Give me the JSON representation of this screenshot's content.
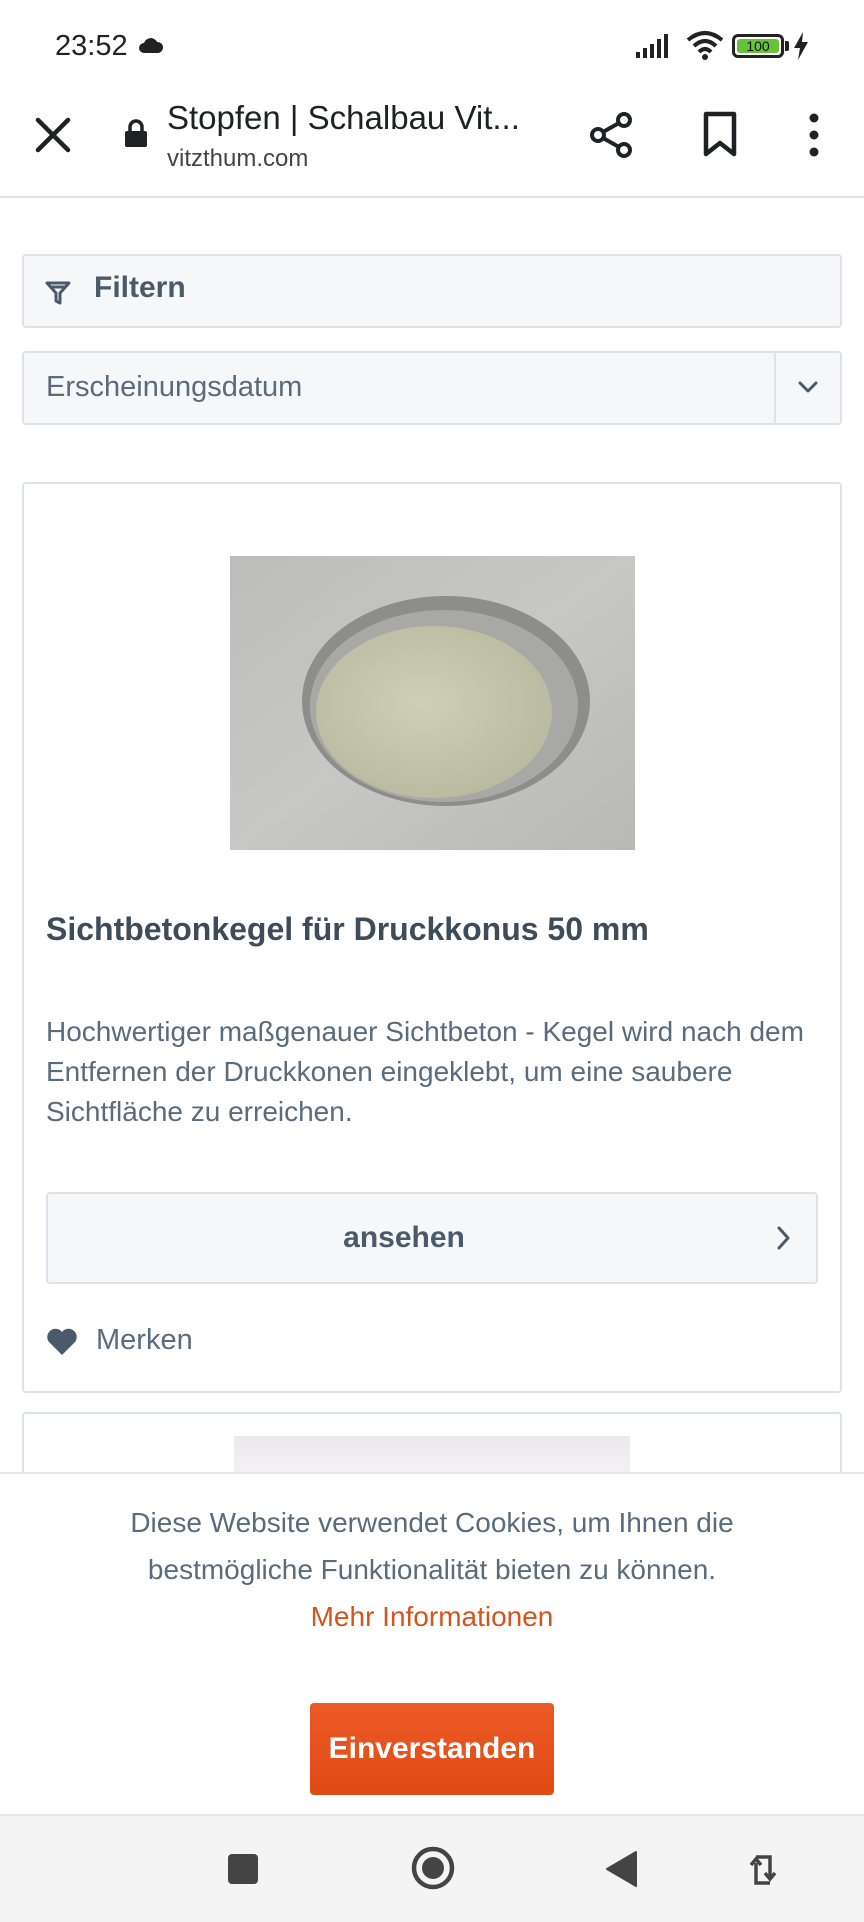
{
  "status_bar": {
    "time": "23:52",
    "battery": "100"
  },
  "browser": {
    "title": "Stopfen | Schalbau Vit...",
    "domain": "vitzthum.com"
  },
  "filter": {
    "label": "Filtern"
  },
  "sort": {
    "selected": "Erscheinungsdatum"
  },
  "product": {
    "name": "Sichtbetonkegel für Druckkonus 50 mm",
    "description": "Hochwertiger maßgenauer Sichtbeton - Kegel wird nach dem Entfernen der Druckkonen eingeklebt, um eine saubere Sichtfläche zu erreichen.",
    "view_label": "ansehen",
    "wishlist_label": "Merken"
  },
  "cookie": {
    "text": "Diese Website verwendet Cookies, um Ihnen die bestmögliche Funktionalität bieten zu können.",
    "link": "Mehr Informationen",
    "accept": "Einverstanden"
  },
  "colors": {
    "accent": "#e04f19",
    "text": "#4a5a6b",
    "border": "#dde2e8"
  }
}
